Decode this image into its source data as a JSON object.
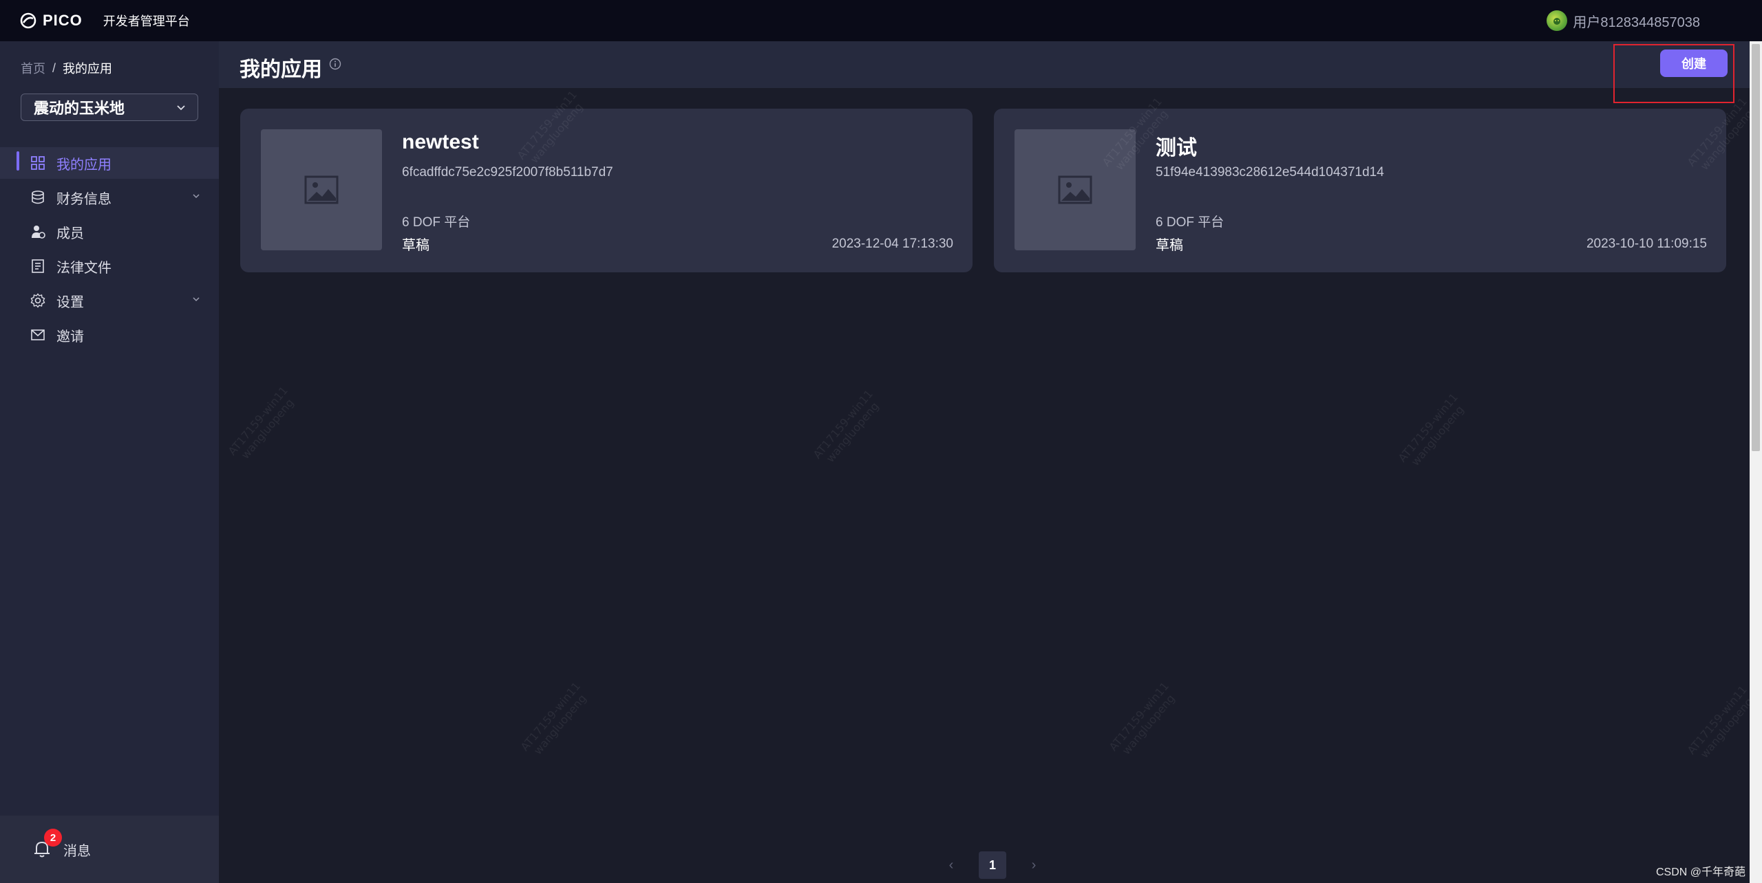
{
  "topbar": {
    "logo_text": "PICO",
    "platform_name": "开发者管理平台",
    "user_name": "用户8128344857038"
  },
  "sidebar": {
    "breadcrumb": {
      "home": "首页",
      "separator": "/",
      "current": "我的应用"
    },
    "org_select": {
      "value": "震动的玉米地"
    },
    "nav_items": [
      {
        "label": "我的应用",
        "icon": "grid-icon",
        "active": true
      },
      {
        "label": "财务信息",
        "icon": "database-icon",
        "has_submenu": true
      },
      {
        "label": "成员",
        "icon": "member-icon"
      },
      {
        "label": "法律文件",
        "icon": "document-icon"
      },
      {
        "label": "设置",
        "icon": "gear-icon",
        "has_submenu": true
      },
      {
        "label": "邀请",
        "icon": "mail-icon"
      }
    ],
    "footer": {
      "messages_label": "消息",
      "badge_count": "2"
    }
  },
  "main": {
    "title": "我的应用",
    "create_button": "创建",
    "apps": [
      {
        "name": "newtest",
        "id": "6fcadffdc75e2c925f2007f8b511b7d7",
        "platform": "6 DOF 平台",
        "status": "草稿",
        "date": "2023-12-04 17:13:30"
      },
      {
        "name": "测试",
        "id": "51f94e413983c28612e544d104371d14",
        "platform": "6 DOF 平台",
        "status": "草稿",
        "date": "2023-10-10 11:09:15"
      }
    ],
    "pagination": {
      "prev": "‹",
      "current_page": "1",
      "next": "›"
    }
  },
  "watermark_text": "AT17159-win11\nwangluopeng",
  "footer_credit": "CSDN @千年奇葩",
  "colors": {
    "accent": "#7b68f5",
    "badge": "#f5222d",
    "highlight": "#e0242f",
    "background": "#1a1c29"
  }
}
